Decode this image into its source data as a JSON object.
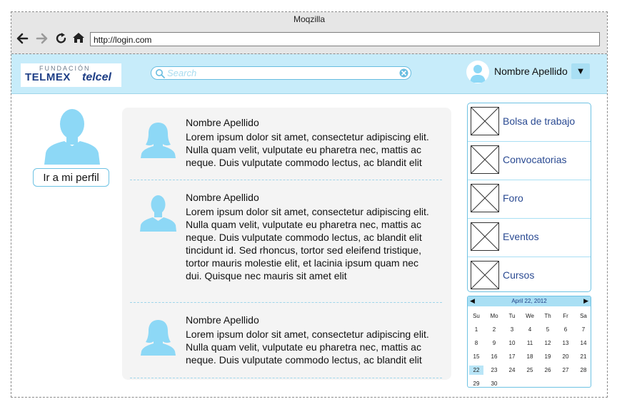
{
  "window": {
    "title": "Moqzilla"
  },
  "browser": {
    "url": "http://login.com",
    "nav_icons": [
      "back-arrow-icon",
      "forward-arrow-icon",
      "reload-icon",
      "home-icon"
    ]
  },
  "header": {
    "logo": {
      "line1": "FUNDACIÓN",
      "line2": "TELMEX",
      "line3": "telcel"
    },
    "search_placeholder": "Search",
    "user_name": "Nombre Apellido",
    "dropdown_glyph": "▼"
  },
  "profile": {
    "button_label": "Ir a mi perfil"
  },
  "feed": {
    "posts": [
      {
        "name": "Nombre Apellido",
        "text": "Lorem ipsum dolor sit amet, consectetur adipiscing elit. Nulla quam velit, vulputate eu pharetra nec, mattis ac neque. Duis vulputate commodo lectus, ac blandit elit",
        "avatar": "female-user-icon"
      },
      {
        "name": "Nombre Apellido",
        "text": "Lorem ipsum dolor sit amet, consectetur adipiscing elit. Nulla quam velit, vulputate eu pharetra nec, mattis ac neque. Duis vulputate commodo lectus, ac blandit elit tincidunt id. Sed rhoncus, tortor sed eleifend tristique, tortor mauris molestie elit, et lacinia ipsum quam nec dui. Quisque nec mauris sit amet elit",
        "avatar": "male-user-icon"
      },
      {
        "name": "Nombre Apellido",
        "text": "Lorem ipsum dolor sit amet, consectetur adipiscing elit. Nulla quam velit, vulputate eu pharetra nec, mattis ac neque. Duis vulputate commodo lectus, ac blandit elit",
        "avatar": "female-user-icon"
      }
    ]
  },
  "menu": {
    "items": [
      {
        "label": "Bolsa de trabajo"
      },
      {
        "label": "Convocatorias"
      },
      {
        "label": "Foro"
      },
      {
        "label": "Eventos"
      },
      {
        "label": "Cursos"
      }
    ]
  },
  "calendar": {
    "title": "April 22, 2012",
    "prev": "◀",
    "next": "▶",
    "weekdays": [
      "Su",
      "Mo",
      "Tu",
      "We",
      "Th",
      "Fr",
      "Sa"
    ],
    "weeks": [
      [
        "1",
        "2",
        "3",
        "4",
        "5",
        "6",
        "7"
      ],
      [
        "8",
        "9",
        "10",
        "11",
        "12",
        "13",
        "14"
      ],
      [
        "15",
        "16",
        "17",
        "18",
        "19",
        "20",
        "21"
      ],
      [
        "22",
        "23",
        "24",
        "25",
        "26",
        "27",
        "28"
      ],
      [
        "29",
        "30",
        "",
        "",
        "",
        "",
        ""
      ]
    ],
    "selected": "22"
  },
  "colors": {
    "header_bg": "#c7ecfa",
    "accent": "#6ec2e3",
    "link": "#2a4a92",
    "avatar": "#8dd8f6"
  }
}
